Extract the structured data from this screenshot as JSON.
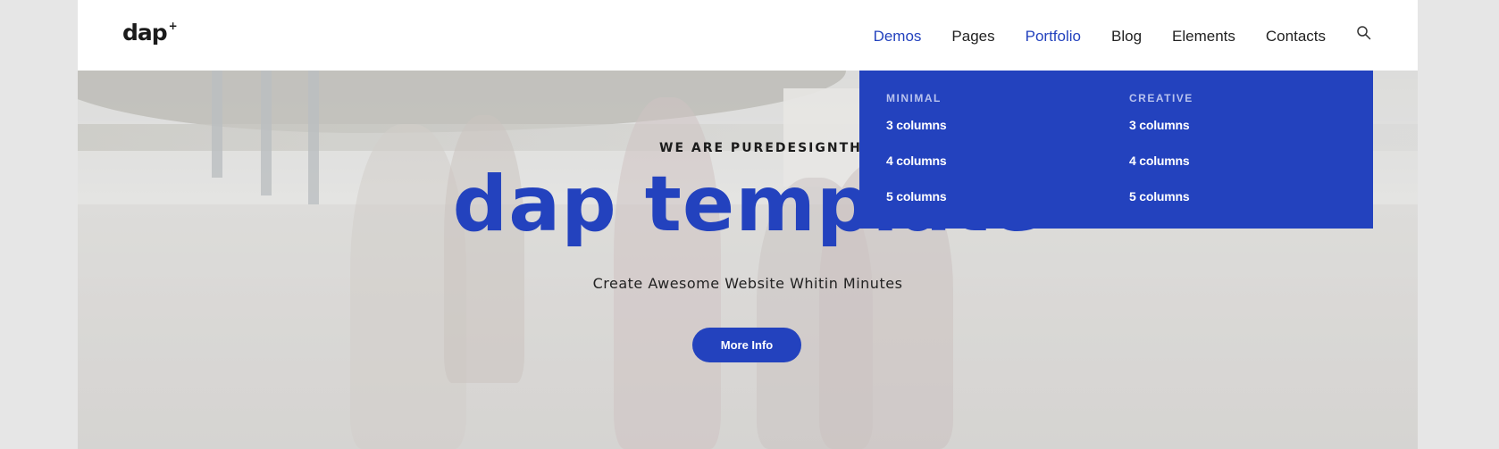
{
  "header": {
    "logo": "dap",
    "logo_mark": "+",
    "nav": [
      "Demos",
      "Pages",
      "Portfolio",
      "Blog",
      "Elements",
      "Contacts"
    ],
    "active_nav": [
      "Demos",
      "Portfolio"
    ],
    "search_icon": "search-icon"
  },
  "hero": {
    "subtitle": "WE ARE PUREDESIGNTHEMES",
    "title": "dap template",
    "tagline": "Create Awesome Website Whitin Minutes",
    "button": "More Info"
  },
  "dropdown": {
    "columns": [
      {
        "heading": "MINIMAL",
        "items": [
          "3 columns",
          "4 columns",
          "5 columns"
        ]
      },
      {
        "heading": "CREATIVE",
        "items": [
          "3 columns",
          "4 columns",
          "5 columns"
        ]
      }
    ]
  },
  "colors": {
    "accent": "#2342be",
    "background": "#e6e6e6",
    "text": "#222222"
  }
}
